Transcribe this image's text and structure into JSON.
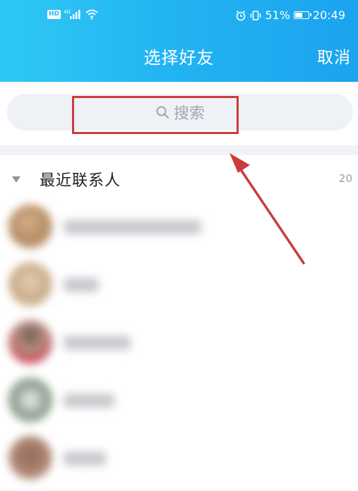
{
  "status_bar": {
    "network": "4G",
    "battery_level": 0.51,
    "battery_text": "51%",
    "time": "20:49"
  },
  "header": {
    "title": "选择好友",
    "cancel_label": "取消"
  },
  "search": {
    "placeholder": "搜索"
  },
  "section": {
    "title": "最近联系人",
    "count": "20"
  },
  "colors": {
    "header_gradient_start": "#2fc8f5",
    "header_gradient_end": "#1ba3ef",
    "annotation_red": "#cc3b3b"
  },
  "icons": {
    "search": "search-icon",
    "collapse": "triangle-down-icon",
    "alarm": "alarm-icon",
    "vibrate": "vibrate-icon",
    "wifi": "wifi-icon",
    "signal": "signal-icon"
  }
}
